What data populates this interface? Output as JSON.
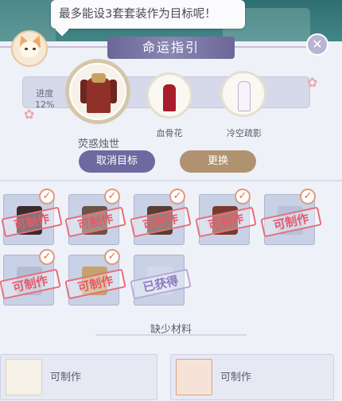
{
  "hint": "最多能设3套套装作为目标呢！",
  "panel_title": "命运指引",
  "progress": {
    "label": "进度",
    "value": "12%"
  },
  "outfits": [
    {
      "name": "荧惑烛世",
      "selected": true
    },
    {
      "name": "血骨花"
    },
    {
      "name": "冷空疏影"
    }
  ],
  "buttons": {
    "cancel": "取消目标",
    "swap": "更换"
  },
  "items": [
    {
      "status": "可制作",
      "checked": true
    },
    {
      "status": "可制作",
      "checked": true
    },
    {
      "status": "可制作",
      "checked": true
    },
    {
      "status": "可制作",
      "checked": true
    },
    {
      "status": "可制作",
      "checked": true
    },
    {
      "status": "可制作",
      "checked": true
    },
    {
      "status": "可制作",
      "checked": true
    },
    {
      "status": "已获得",
      "checked": false
    }
  ],
  "missing": {
    "title": "缺少材料",
    "materials": [
      {
        "status": "可制作"
      },
      {
        "status": "可制作"
      }
    ]
  },
  "colors": {
    "accent": "#6e6aa0",
    "swap": "#b09270",
    "stamp": "#e65a6a"
  },
  "icons": {
    "close": "close-icon",
    "check": "check-icon"
  }
}
